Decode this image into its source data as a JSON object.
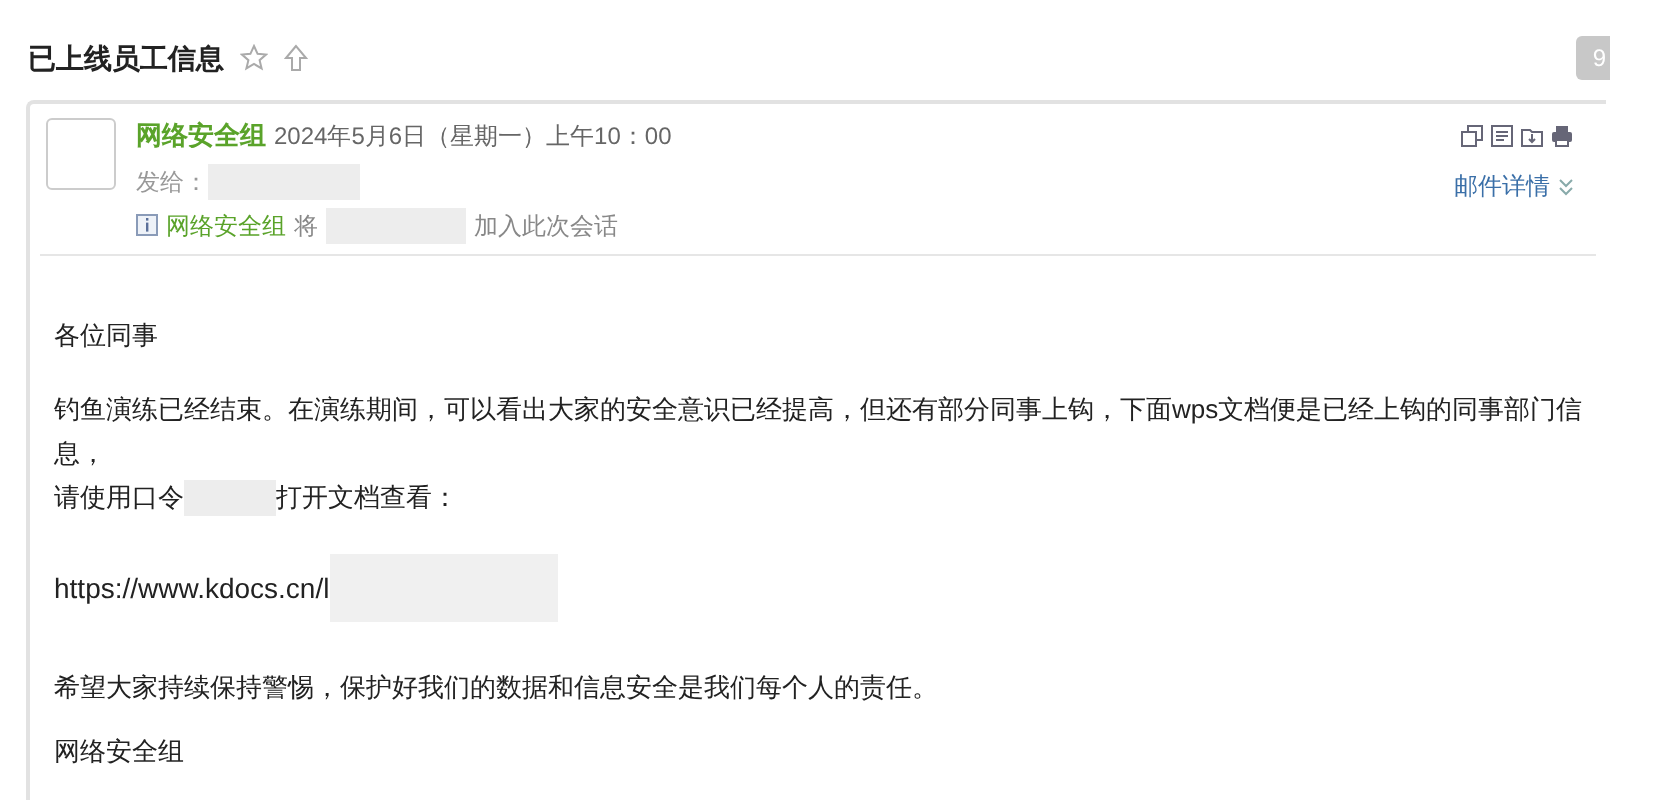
{
  "subject": {
    "title": "已上线员工信息",
    "badge": "9"
  },
  "header": {
    "sender": "网络安全组",
    "date": "2024年5月6日（星期一）上午10：00",
    "to_label": "发给：",
    "notice": {
      "actor": "网络安全组",
      "verb": "将",
      "action": "加入此次会话"
    },
    "details_link": "邮件详情"
  },
  "body": {
    "greeting": "各位同事",
    "paragraph_1": "钓鱼演练已经结束。在演练期间，可以看出大家的安全意识已经提高，但还有部分同事上钩，下面wps文档便是已经上钩的同事部门信息，",
    "paragraph_2_before": "请使用口令",
    "paragraph_2_after": "打开文档查看：",
    "link": "https://www.kdocs.cn/l",
    "closing": "希望大家持续保持警惕，保护好我们的数据和信息安全是我们每个人的责任。",
    "signature": "网络安全组"
  }
}
